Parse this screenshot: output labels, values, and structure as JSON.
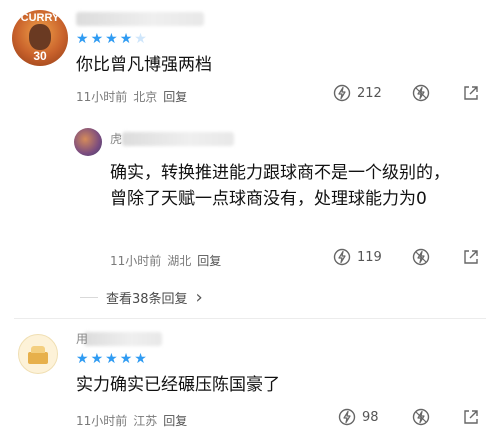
{
  "comments": [
    {
      "avatar_text": "CURRY",
      "avatar_number": "30",
      "stars_filled": 4,
      "stars_total": 5,
      "text": "你比曾凡博强两档",
      "time": "11小时前",
      "location": "北京",
      "reply_label": "回复",
      "like_count": "212"
    },
    {
      "name_fragment": "虎",
      "text": "确实，转换推进能力跟球商不是一个级别的，曾除了天赋一点球商没有，处理球能力为0",
      "time": "11小时前",
      "location": "湖北",
      "reply_label": "回复",
      "like_count": "119",
      "more_replies_label": "查看38条回复",
      "more_replies_arrow": "›"
    },
    {
      "name_fragment": "用",
      "stars_filled": 5,
      "stars_total": 5,
      "text": "实力确实已经碾压陈国豪了",
      "time": "11小时前",
      "location": "江苏",
      "reply_label": "回复",
      "like_count": "98"
    }
  ],
  "icons": {
    "like": "lightning-like-icon",
    "dislike": "lightning-dislike-icon",
    "share": "share-icon",
    "star": "star-icon"
  },
  "colors": {
    "star": "#2f9bf2",
    "meta_text": "#7a7a7a"
  }
}
